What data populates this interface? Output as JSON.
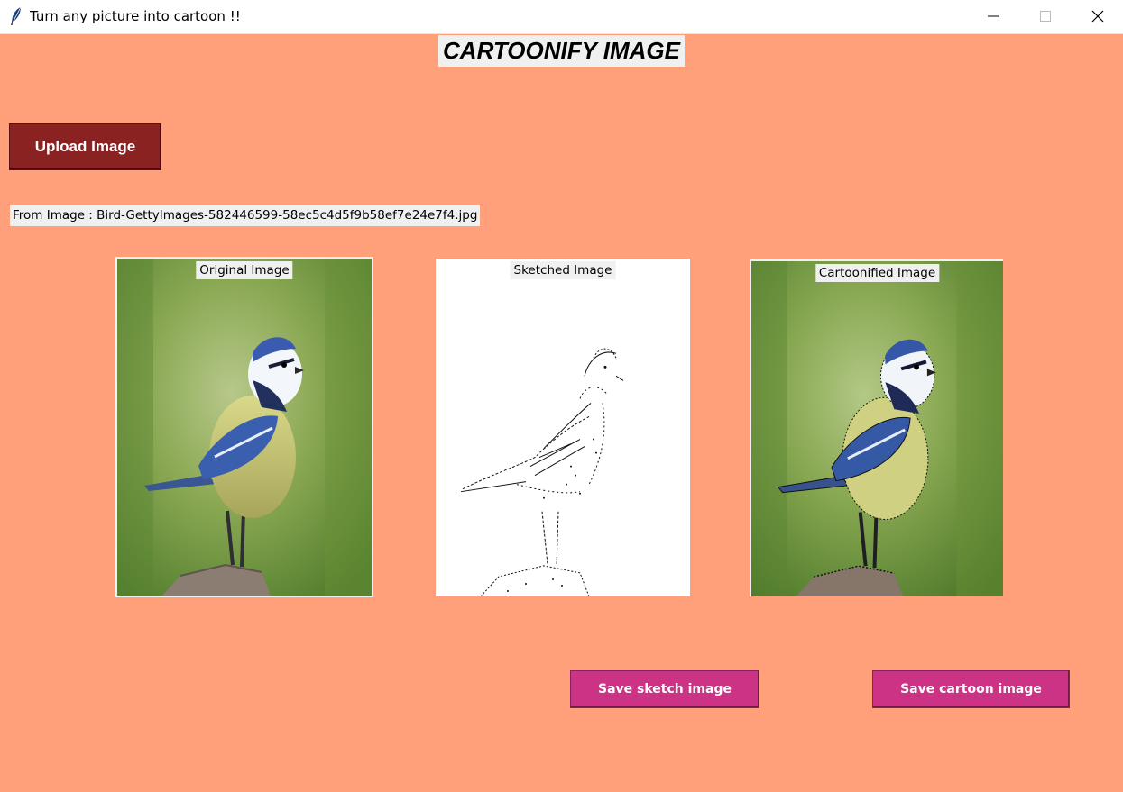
{
  "window": {
    "title": "Turn any picture into cartoon !!",
    "icon": "feather-icon",
    "controls": [
      "minimize-icon",
      "maximize-icon",
      "close-icon"
    ]
  },
  "heading": "CARTOONIFY IMAGE",
  "upload_button": "Upload Image",
  "from_image": "From Image : Bird-GettyImages-582446599-58ec5c4d5f9b58ef7e24e7f4.jpg",
  "panels": {
    "original": "Original Image",
    "sketched": "Sketched Image",
    "cartoonified": "Cartoonified Image"
  },
  "buttons": {
    "save_sketch": "Save sketch image",
    "save_cartoon": "Save cartoon image"
  },
  "colors": {
    "background": "#ffa07a",
    "upload_button": "#8b2222",
    "save_buttons": "#cc3385"
  }
}
